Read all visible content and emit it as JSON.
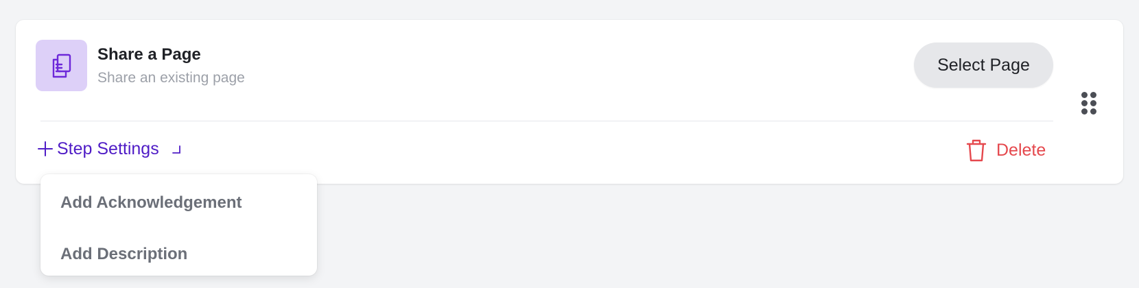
{
  "step": {
    "title": "Share a Page",
    "subtitle": "Share an existing page",
    "icon": "document-copy-icon",
    "icon_tile_color": "#ddd0f8",
    "icon_color": "#6d28d9"
  },
  "actions": {
    "select_label": "Select Page",
    "delete_label": "Delete",
    "delete_color": "#e5484d"
  },
  "settings": {
    "toggle_label": "Step Settings",
    "toggle_color": "#4f1cc6",
    "menu_items": [
      {
        "label": "Add Acknowledgement"
      },
      {
        "label": "Add Description"
      }
    ]
  }
}
